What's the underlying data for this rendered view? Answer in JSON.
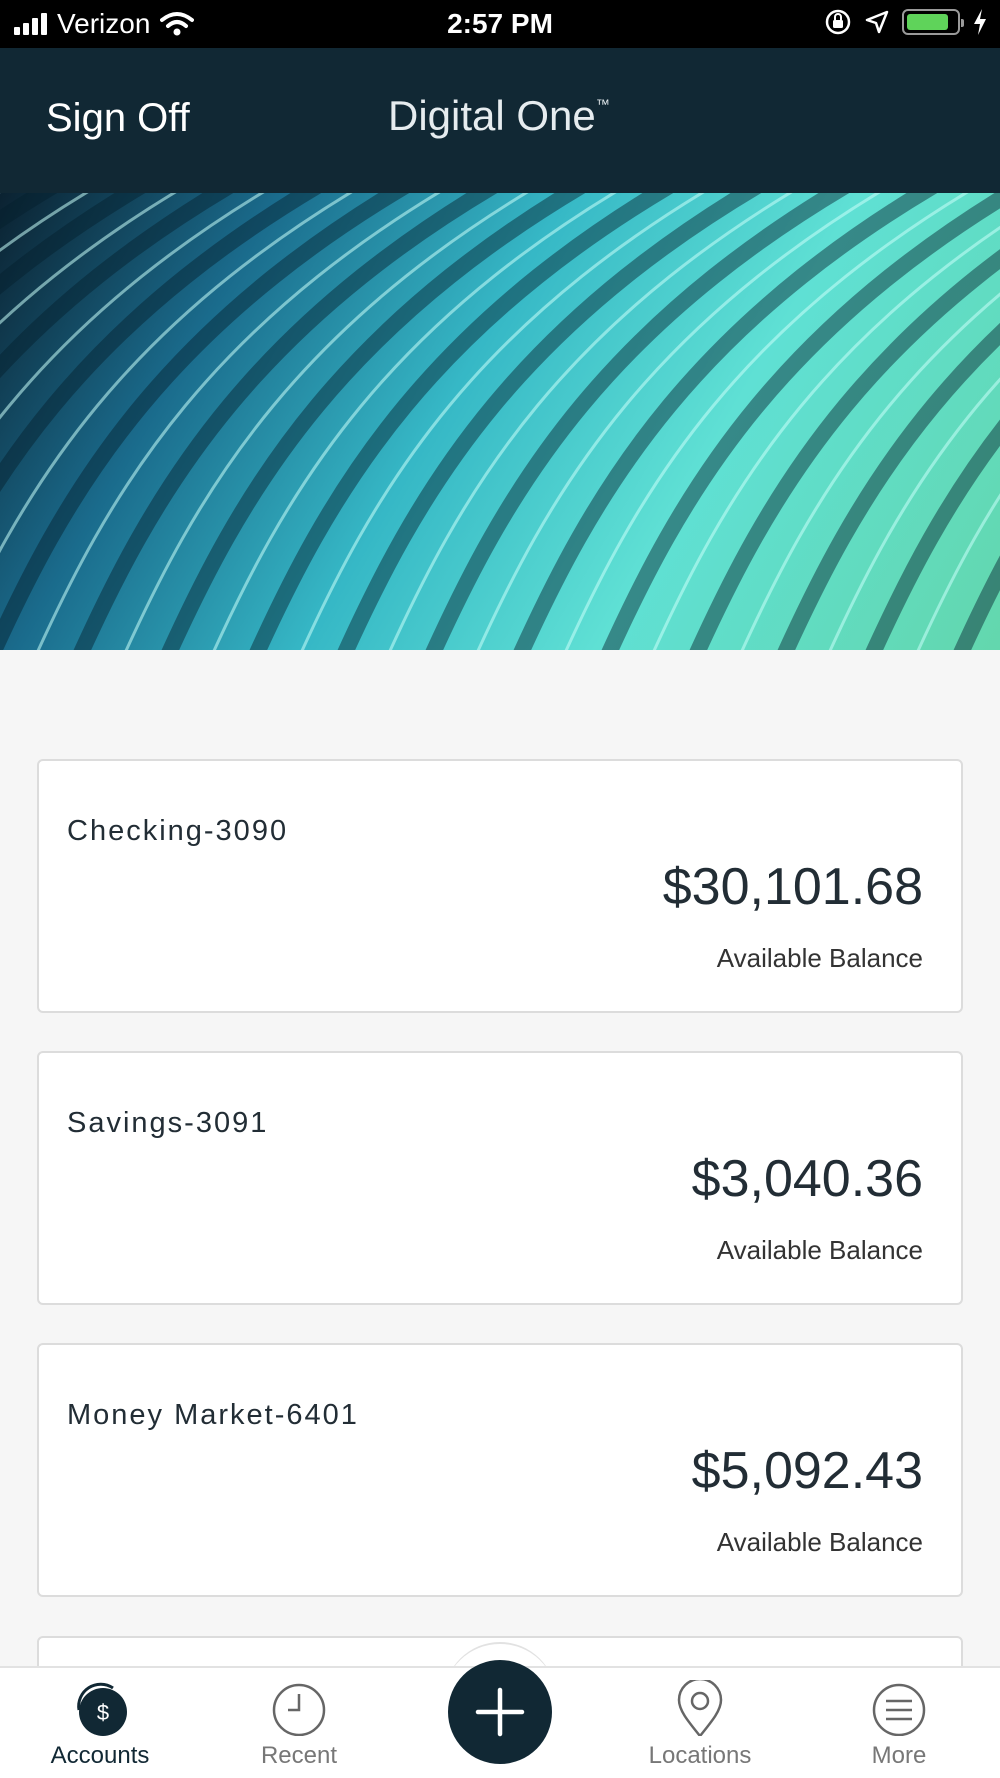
{
  "status_bar": {
    "carrier": "Verizon",
    "time": "2:57 PM",
    "battery_level": 0.85,
    "icons": [
      "signal-icon",
      "wifi-icon",
      "orientation-lock-icon",
      "location-arrow-icon",
      "battery-icon",
      "charging-bolt-icon"
    ]
  },
  "header": {
    "sign_off": "Sign Off",
    "title": "Digital One",
    "trademark": "™"
  },
  "accounts": [
    {
      "name": "Checking-3090",
      "balance": "$30,101.68",
      "label": "Available Balance"
    },
    {
      "name": "Savings-3091",
      "balance": "$3,040.36",
      "label": "Available Balance"
    },
    {
      "name": "Money Market-6401",
      "balance": "$5,092.43",
      "label": "Available Balance"
    }
  ],
  "tab_bar": {
    "tabs": [
      {
        "label": "Accounts",
        "icon": "accounts-dollar-icon",
        "active": true
      },
      {
        "label": "Recent",
        "icon": "clock-icon",
        "active": false
      },
      {
        "label": "",
        "icon": "plus-icon",
        "active": false
      },
      {
        "label": "Locations",
        "icon": "location-pin-icon",
        "active": false
      },
      {
        "label": "More",
        "icon": "menu-icon",
        "active": false
      }
    ]
  },
  "colors": {
    "header_bg": "#112834",
    "page_bg": "#f6f6f6",
    "card_border": "#dcdcdc",
    "accent": "#112834"
  }
}
